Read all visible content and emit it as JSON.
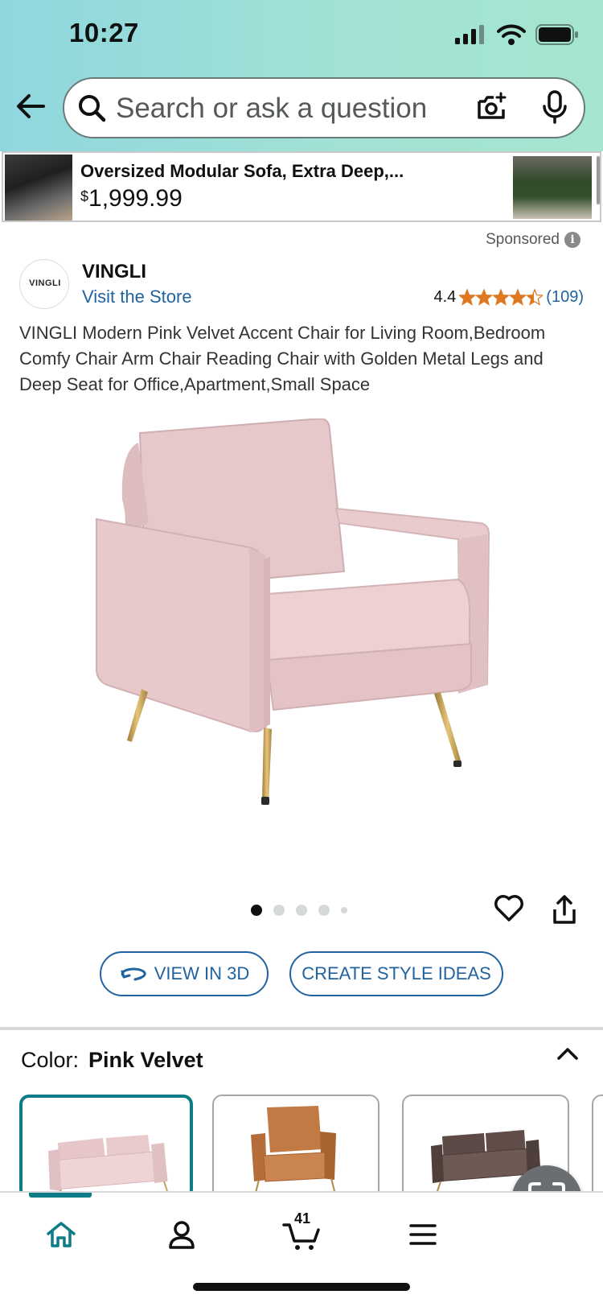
{
  "status_bar": {
    "time": "10:27"
  },
  "search": {
    "placeholder": "Search or ask a question"
  },
  "ad_banner": {
    "title": "Oversized Modular Sofa, Extra Deep,...",
    "price_symbol": "$",
    "price": "1,999.99"
  },
  "sponsored_label": "Sponsored",
  "brand": {
    "logo_text": "VINGLI",
    "name": "VINGLI",
    "store_link": "Visit the Store"
  },
  "rating": {
    "value": "4.4",
    "stars": 4.4,
    "count": "(109)"
  },
  "product": {
    "title": "VINGLI Modern Pink Velvet Accent Chair for Living Room,Bedroom Comfy Chair Arm Chair Reading Chair with Golden Metal Legs and Deep Seat for Office,Apartment,Small Space",
    "image_count": 5,
    "active_image": 1
  },
  "actions": {
    "view_3d": "VIEW IN 3D",
    "style_ideas": "CREATE STYLE IDEAS"
  },
  "color": {
    "label": "Color:",
    "value": "Pink Velvet"
  },
  "cart": {
    "count": "41"
  },
  "colors": {
    "accent": "#0e7c86",
    "link": "#2162a1",
    "star": "#de7921"
  }
}
